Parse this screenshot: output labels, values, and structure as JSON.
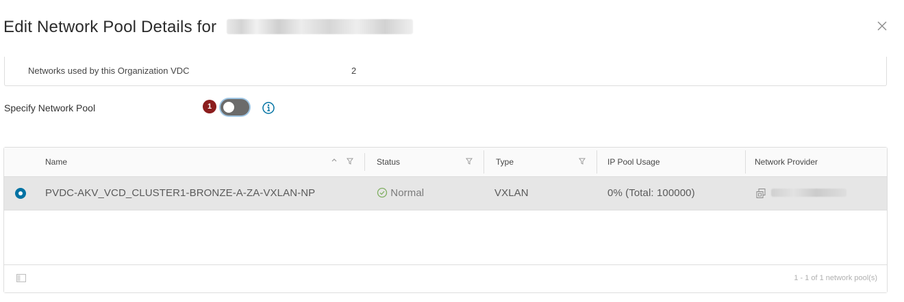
{
  "dialog": {
    "title": "Edit Network Pool Details for",
    "close_icon": "close-icon"
  },
  "info": {
    "networks_label": "Networks used by this Organization VDC",
    "networks_value": "2"
  },
  "specify": {
    "label": "Specify Network Pool",
    "badge": "1",
    "toggle_on": false
  },
  "grid": {
    "columns": [
      "Name",
      "Status",
      "Type",
      "IP Pool Usage",
      "Network Provider"
    ],
    "rows": [
      {
        "selected": true,
        "name": "PVDC-AKV_VCD_CLUSTER1-BRONZE-A-ZA-VXLAN-NP",
        "status": "Normal",
        "type": "VXLAN",
        "ip_pool_usage": "0% (Total: 100000)"
      }
    ],
    "footer_count": "1 - 1 of 1 network pool(s)"
  },
  "colors": {
    "accent": "#0072a3",
    "badge": "#8b1d1d",
    "status_ok": "#2f8400"
  }
}
